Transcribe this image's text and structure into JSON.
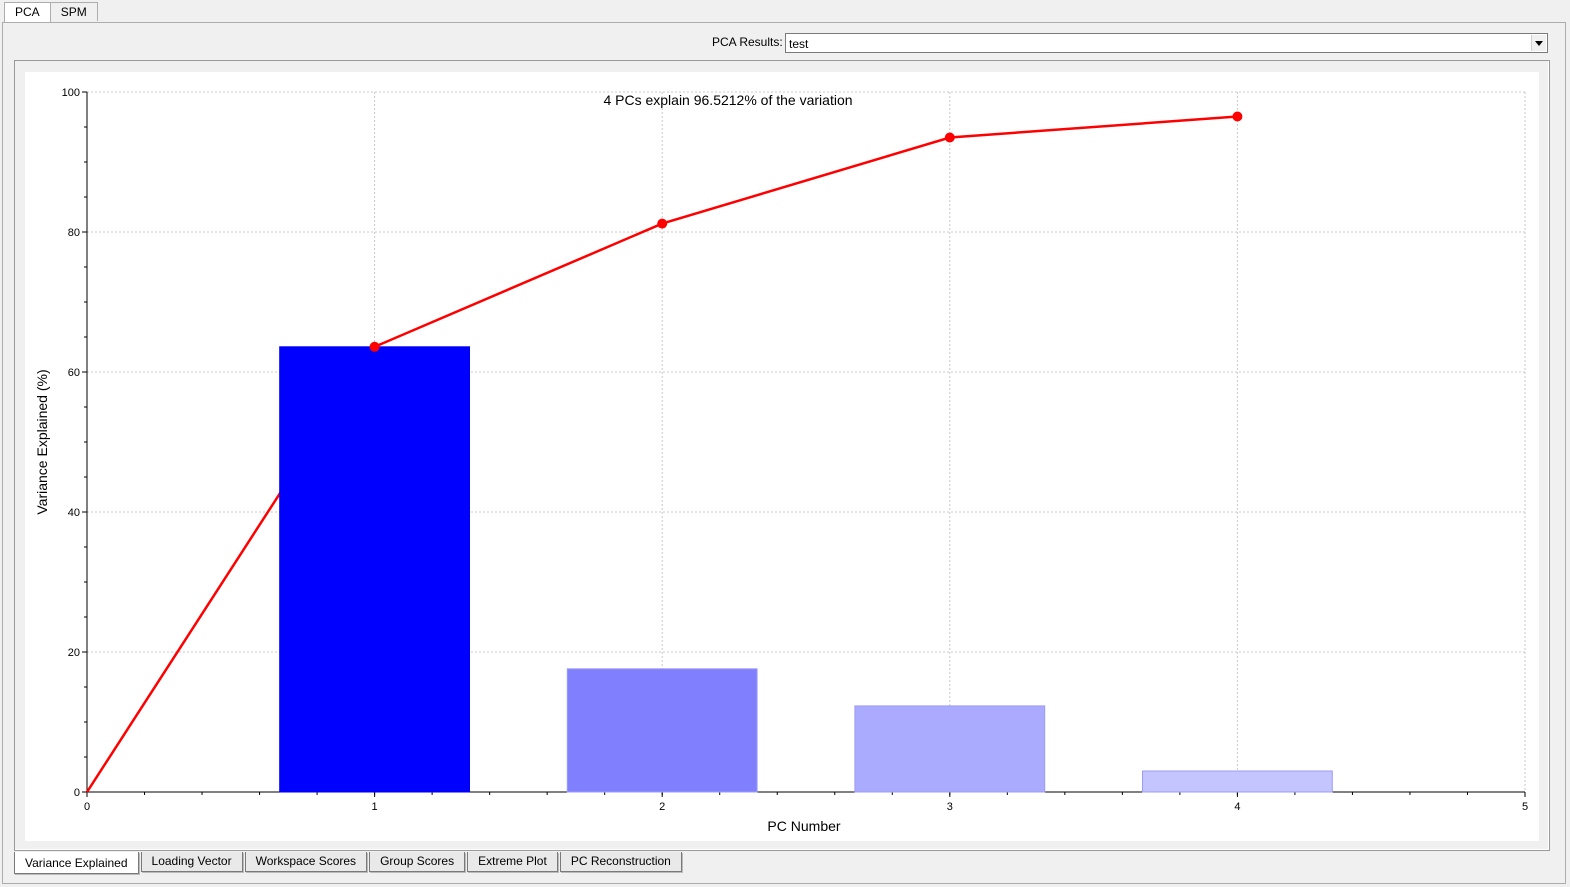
{
  "top_tabs": [
    {
      "label": "PCA",
      "active": true
    },
    {
      "label": "SPM",
      "active": false
    }
  ],
  "pca_results": {
    "label": "PCA Results:",
    "selected": "test"
  },
  "bottom_tabs": [
    {
      "label": "Variance Explained",
      "active": true
    },
    {
      "label": "Loading Vector",
      "active": false
    },
    {
      "label": "Workspace Scores",
      "active": false
    },
    {
      "label": "Group Scores",
      "active": false
    },
    {
      "label": "Extreme Plot",
      "active": false
    },
    {
      "label": "PC Reconstruction",
      "active": false
    }
  ],
  "colors": {
    "line": "#ff0000",
    "bars": [
      "#0000ff",
      "#8080ff",
      "#aaaaff",
      "#c4c4ff"
    ]
  },
  "chart_data": {
    "type": "bar",
    "title": "4 PCs explain 96.5212% of the variation",
    "xlabel": "PC Number",
    "ylabel": "Variance Explained (%)",
    "xlim": [
      0,
      5
    ],
    "ylim": [
      0,
      100
    ],
    "xticks": [
      "0",
      "1",
      "2",
      "3",
      "4",
      "5"
    ],
    "yticks": [
      "0",
      "20",
      "40",
      "60",
      "80",
      "100"
    ],
    "grid": true,
    "categories": [
      1,
      2,
      3,
      4
    ],
    "values": [
      63.6,
      17.6,
      12.3,
      3.0
    ],
    "cumulative_line": {
      "x": [
        0,
        1,
        2,
        3,
        4
      ],
      "y": [
        0,
        63.6,
        81.2,
        93.5,
        96.5
      ]
    }
  }
}
